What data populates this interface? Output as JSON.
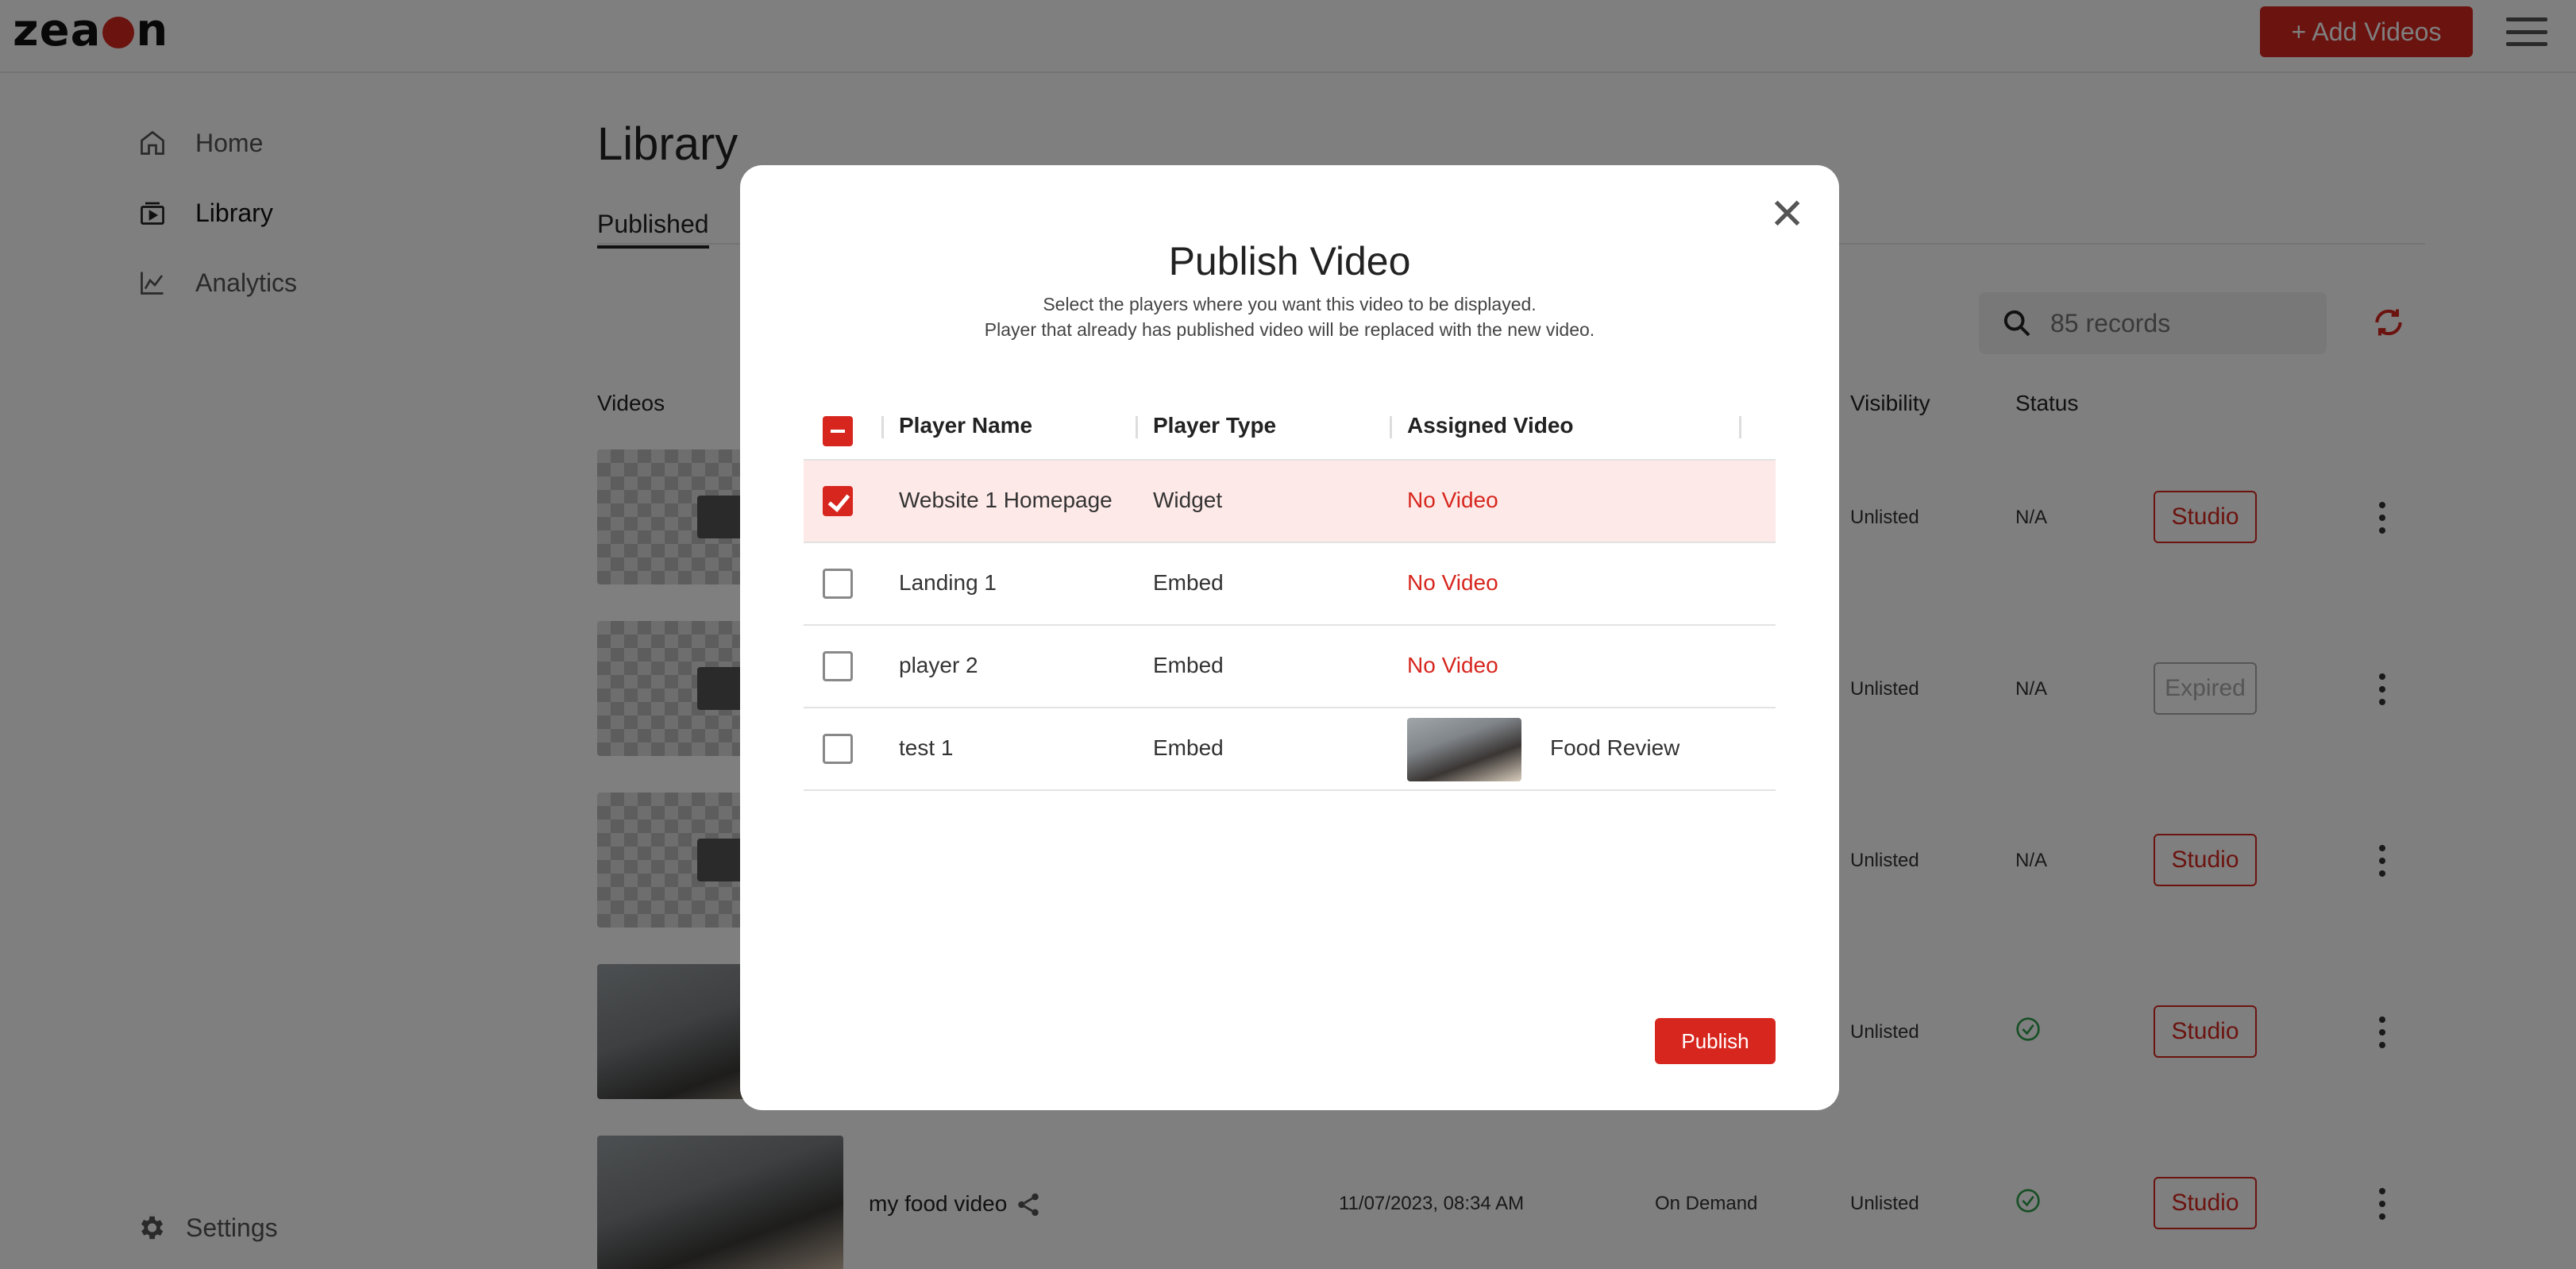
{
  "header": {
    "logo_text": "zeacon",
    "add_videos_label": "+ Add Videos"
  },
  "sidebar": {
    "items": [
      {
        "label": "Home",
        "icon": "home-icon"
      },
      {
        "label": "Library",
        "icon": "library-icon"
      },
      {
        "label": "Analytics",
        "icon": "analytics-icon"
      }
    ],
    "settings_label": "Settings"
  },
  "main": {
    "title": "Library",
    "tab_published": "Published",
    "search": {
      "placeholder": "85 records"
    },
    "columns": {
      "videos": "Videos",
      "visibility": "Visibility",
      "status": "Status"
    },
    "rows": [
      {
        "visibility": "Unlisted",
        "status": "N/A",
        "action": "Studio"
      },
      {
        "visibility": "Unlisted",
        "status": "N/A",
        "action": "Expired"
      },
      {
        "visibility": "Unlisted",
        "status": "N/A",
        "action": "Studio"
      },
      {
        "visibility": "Unlisted",
        "status": "ok",
        "action": "Studio"
      },
      {
        "name": "my food video",
        "date": "11/07/2023, 08:34 AM",
        "type": "On Demand",
        "visibility": "Unlisted",
        "status": "ok",
        "action": "Studio"
      }
    ]
  },
  "modal": {
    "title": "Publish Video",
    "subtitle_1": "Select the players where you want this video to be displayed.",
    "subtitle_2": "Player that already has published video will be replaced with the new video.",
    "headers": {
      "player_name": "Player Name",
      "player_type": "Player Type",
      "assigned_video": "Assigned Video"
    },
    "rows": [
      {
        "player_name": "Website 1 Homepage",
        "player_type": "Widget",
        "assigned_video": "No Video",
        "checked": true
      },
      {
        "player_name": "Landing 1",
        "player_type": "Embed",
        "assigned_video": "No Video",
        "checked": false
      },
      {
        "player_name": "player 2",
        "player_type": "Embed",
        "assigned_video": "No Video",
        "checked": false
      },
      {
        "player_name": "test 1",
        "player_type": "Embed",
        "assigned_video": "Food Review",
        "checked": false
      }
    ],
    "publish_label": "Publish",
    "close_symbol": "✕"
  },
  "colors": {
    "accent": "#d7261e",
    "selected_row": "#fde9e7",
    "success": "#2e9e4a"
  }
}
